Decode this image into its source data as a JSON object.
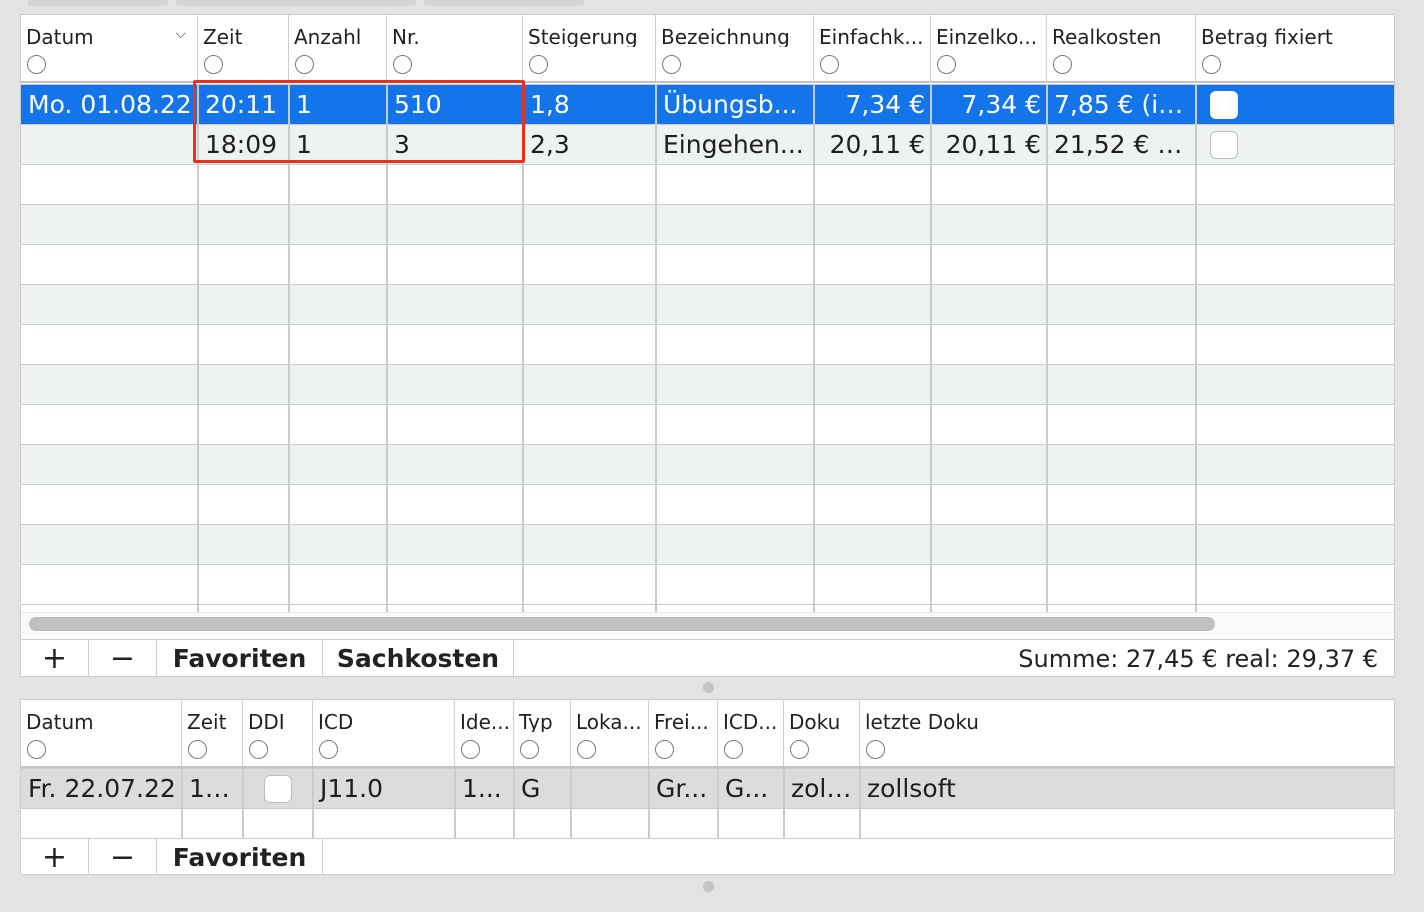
{
  "table1": {
    "columns": [
      {
        "key": "datum",
        "label": "Datum",
        "sorted": true
      },
      {
        "key": "zeit",
        "label": "Zeit"
      },
      {
        "key": "anzahl",
        "label": "Anzahl"
      },
      {
        "key": "nr",
        "label": "Nr."
      },
      {
        "key": "steigerung",
        "label": "Steigerung"
      },
      {
        "key": "bezeichnung",
        "label": "Bezeichnung"
      },
      {
        "key": "einfach",
        "label": "Einfachk..."
      },
      {
        "key": "einzel",
        "label": "Einzelko..."
      },
      {
        "key": "real",
        "label": "Realkosten"
      },
      {
        "key": "fixiert",
        "label": "Betrag fixiert"
      }
    ],
    "rows": [
      {
        "datum": "Mo. 01.08.22",
        "zeit": "20:11",
        "anzahl": "1",
        "nr": "510",
        "steigerung": "1,8",
        "bezeichnung": "Übungsb...",
        "einfach": "7,34 €",
        "einzel": "7,34 €",
        "real": "7,85 € (in...",
        "fixiert": false,
        "selected": true
      },
      {
        "datum": "",
        "zeit": "18:09",
        "anzahl": "1",
        "nr": "3",
        "steigerung": "2,3",
        "bezeichnung": "Eingehen...",
        "einfach": "20,11 €",
        "einzel": "20,11 €",
        "real": "21,52 € (i...",
        "fixiert": false,
        "selected": false
      }
    ],
    "toolbar": {
      "add": "+",
      "remove": "−",
      "favoriten": "Favoriten",
      "sachkosten": "Sachkosten",
      "summe": "Summe: 27,45 € real: 29,37 €"
    }
  },
  "table2": {
    "columns": [
      {
        "key": "datum",
        "label": "Datum"
      },
      {
        "key": "zeit",
        "label": "Zeit"
      },
      {
        "key": "ddi",
        "label": "DDI"
      },
      {
        "key": "icd",
        "label": "ICD"
      },
      {
        "key": "ide",
        "label": "Ide..."
      },
      {
        "key": "typ",
        "label": "Typ"
      },
      {
        "key": "loka",
        "label": "Loka..."
      },
      {
        "key": "frei",
        "label": "Frei..."
      },
      {
        "key": "icd2",
        "label": "ICD..."
      },
      {
        "key": "doku",
        "label": "Doku"
      },
      {
        "key": "letzte",
        "label": "letzte Doku"
      }
    ],
    "rows": [
      {
        "datum": "Fr. 22.07.22",
        "zeit": "14...",
        "ddi": false,
        "icd": "J11.0",
        "ide": "1...",
        "typ": "G",
        "loka": "",
        "frei": "Gr...",
        "icd2": "G...",
        "doku": "zoll...",
        "letzte": "zollsoft"
      }
    ],
    "toolbar": {
      "add": "+",
      "remove": "−",
      "favoriten": "Favoriten"
    }
  },
  "colors": {
    "selection": "#1475ea",
    "highlight_box": "#e8321e",
    "row_alt": "#eff2f2"
  }
}
